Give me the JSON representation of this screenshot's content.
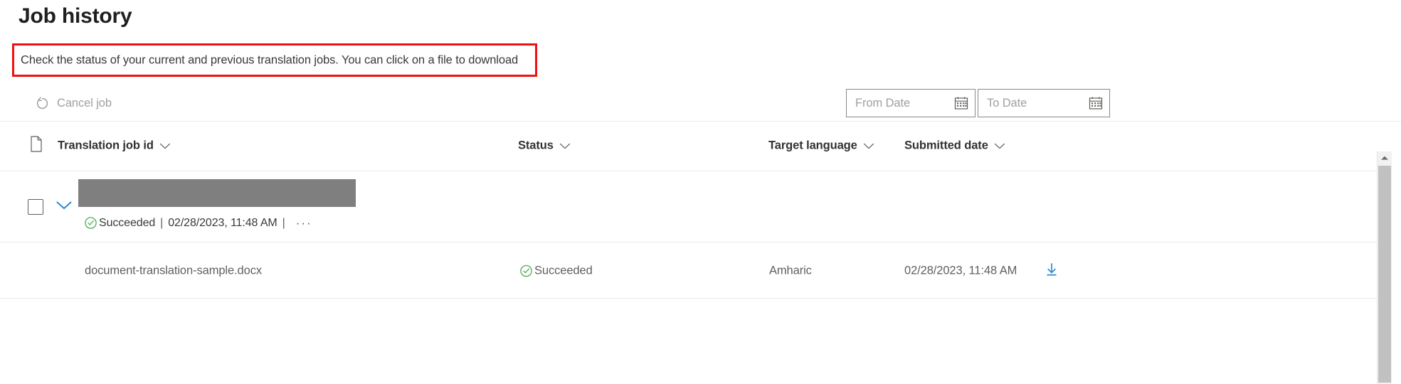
{
  "page": {
    "title": "Job history",
    "description": "Check the status of your current and previous translation jobs. You can click on a file to download",
    "highlight_color": "#ee1111"
  },
  "command_bar": {
    "cancel_job": {
      "label": "Cancel job",
      "icon": "cancel-circle-arrow-icon",
      "disabled_color": "#a19f9d"
    },
    "from_date": {
      "value": "",
      "placeholder": "From Date",
      "icon": "calendar-icon"
    },
    "to_date": {
      "value": "",
      "placeholder": "To Date",
      "icon": "calendar-icon"
    }
  },
  "table": {
    "columns": [
      {
        "key": "jobid",
        "label": "Translation job id",
        "sort_icon": "chevron-down-icon"
      },
      {
        "key": "status",
        "label": "Status",
        "sort_icon": "chevron-down-icon"
      },
      {
        "key": "language",
        "label": "Target language",
        "sort_icon": "chevron-down-icon"
      },
      {
        "key": "date",
        "label": "Submitted date",
        "sort_icon": "chevron-down-icon"
      }
    ],
    "header_file_icon": "file-document-icon",
    "group_row": {
      "checkbox_checked": false,
      "expanded": true,
      "expand_icon": "chevron-down-icon",
      "job_id_redacted": true,
      "status": "Succeeded",
      "status_icon": "check-circle-icon",
      "status_color": "#4caf50",
      "separator": "|",
      "submitted": "02/28/2023, 11:48 AM",
      "overflow_label": "···",
      "overflow_color": "#0f6cbd"
    },
    "rows": [
      {
        "filename": "document-translation-sample.docx",
        "status": "Succeeded",
        "status_icon": "check-circle-icon",
        "language": "Amharic",
        "submitted": "02/28/2023, 11:48 AM",
        "download_icon": "download-icon",
        "download_color": "#2b88d8"
      }
    ]
  },
  "scrollbar": {
    "up_arrow_icon": "caret-up-icon",
    "thumb_color": "#c1c1c1",
    "track_color": "#f2f2f2"
  }
}
